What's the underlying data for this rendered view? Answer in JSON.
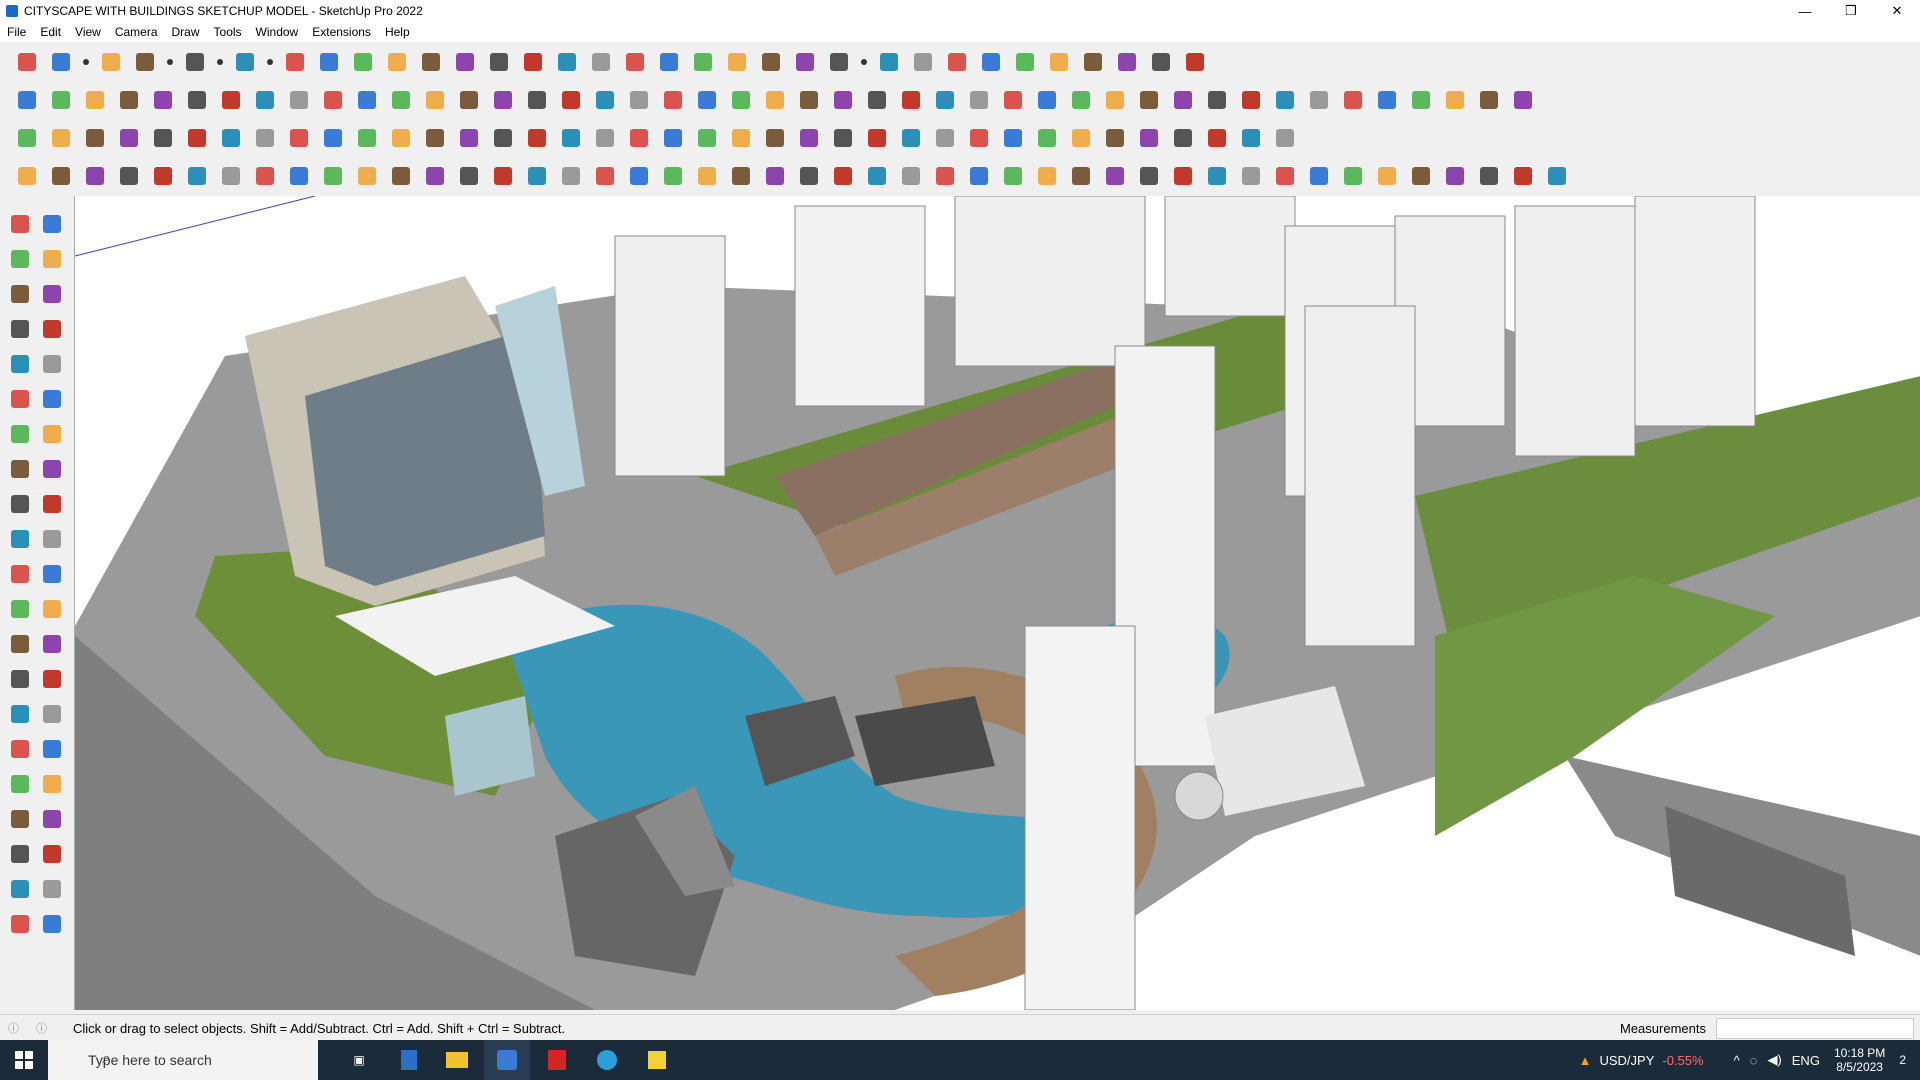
{
  "window": {
    "title": "CITYSCAPE WITH BUILDINGS SKETCHUP MODEL - SketchUp Pro 2022",
    "minimize": "—",
    "maximize": "❒",
    "close": "✕"
  },
  "menu": [
    "File",
    "Edit",
    "View",
    "Camera",
    "Draw",
    "Tools",
    "Window",
    "Extensions",
    "Help"
  ],
  "toolbar_rows": [
    [
      "zoom-icon",
      "select-icon",
      "dropdown-icon",
      "eraser-icon",
      "pencil-icon",
      "dropdown-icon",
      "lasso-icon",
      "dropdown-icon",
      "shape-icon",
      "dropdown-icon",
      "push-pull-icon",
      "follow-me-icon",
      "move-icon",
      "rotate-icon",
      "scale-icon",
      "tape-icon",
      "text-icon",
      "paint-icon",
      "orbit-icon",
      "pan-icon",
      "zoom-icon",
      "zoom-extents-icon",
      "component-icon",
      "sandbox-icon",
      "layers-icon",
      "styles-icon",
      "user-icon",
      "dropdown-icon",
      "warehouse-icon",
      "extension-icon",
      "section-icon",
      "align-icon",
      "flip-icon",
      "explode-icon",
      "hide-icon",
      "undo-icon",
      "redo-icon",
      "geo-icon"
    ],
    [
      "box-icon",
      "box-icon",
      "box-icon",
      "arrow-down-icon",
      "arrow-down-icon",
      "arrow-down-icon",
      "arrow-down-icon",
      "arrow-down-icon",
      "arrow-down-icon",
      "arrow-down-icon",
      "arc-icon",
      "line-icon",
      "line-icon",
      "line-icon",
      "plane-icon",
      "plane-icon",
      "house-icon",
      "house-icon",
      "house-icon",
      "house-icon",
      "house-icon",
      "house-icon",
      "text-tool-icon",
      "shape-icon",
      "pen-icon",
      "circle-icon",
      "circle-icon",
      "circle-icon",
      "circle-icon",
      "circle-icon",
      "circle-icon",
      "circle-icon",
      "circle-icon",
      "circle-icon",
      "circle-icon",
      "circle-icon",
      "pencil-icon",
      "eraser-icon",
      "cube-icon",
      "cube-icon",
      "cube-icon",
      "cube-icon",
      "cube-icon",
      "cube-icon",
      "cube-icon"
    ],
    [
      "gem-icon",
      "gem-icon",
      "gem-icon",
      "gem-icon",
      "gem-icon",
      "gem-icon",
      "curve-icon",
      "rect-icon",
      "rect-icon",
      "rect-icon",
      "rect-icon",
      "rect-icon",
      "rect-icon",
      "curve-icon",
      "cross-icon",
      "cross-icon",
      "cross-icon",
      "cone-icon",
      "cone-icon",
      "triangle-icon",
      "loop-icon",
      "loop-icon",
      "loop-icon",
      "plus-icon",
      "cube-icon",
      "redo-icon",
      "cube-icon",
      "cube-icon",
      "cube-icon",
      "cube-icon",
      "gem-icon",
      "grid-icon",
      "grid-icon",
      "grid-icon",
      "grid-icon",
      "grid-icon",
      "arc-icon",
      "grid-icon"
    ],
    [
      "grid-icon",
      "curve-icon",
      "curve-icon",
      "scissors-icon",
      "star-icon",
      "star-icon",
      "bend-icon",
      "cube-icon",
      "sphere-icon",
      "bend-icon",
      "line-icon",
      "line-icon",
      "line-icon",
      "line-icon",
      "frame-icon",
      "frame-icon",
      "stair-icon",
      "stair-icon",
      "stair-icon",
      "stair-icon",
      "stair-icon",
      "stair-icon",
      "stair-icon",
      "stair-icon",
      "stair-icon",
      "stair-icon",
      "stair-icon",
      "stair-icon",
      "stair-icon",
      "stair-icon",
      "stair-icon",
      "stair-icon",
      "stair-icon",
      "stair-icon",
      "stair-icon",
      "stair-icon",
      "stair-icon",
      "stair-icon",
      "stair-icon",
      "stair-icon",
      "stair-icon",
      "stair-icon",
      "stair-icon",
      "stair-icon",
      "stair-icon",
      "stair-icon"
    ]
  ],
  "left_tools": [
    "select-icon",
    "orbit-icon",
    "paint-icon",
    "eraser-icon",
    "cube-icon",
    "pencil-icon",
    "line-icon",
    "freehand-icon",
    "rect-icon",
    "rotated-rect-icon",
    "circle-icon",
    "polygon-icon",
    "arc-icon",
    "arc-icon",
    "pie-icon",
    "arc-icon",
    "move-icon",
    "push-pull-icon",
    "rotate-icon",
    "follow-me-icon",
    "scale-icon",
    "offset-icon",
    "tape-icon",
    "dimension-icon",
    "protractor-icon",
    "text-icon",
    "axes-icon",
    "3d-text-icon",
    "orbit-icon",
    "pan-icon",
    "zoom-icon",
    "zoom-window-icon",
    "zoom-extents-icon",
    "previous-icon",
    "position-camera-icon",
    "look-around-icon",
    "walk-icon",
    "section-icon",
    "sandbox-icon",
    "sandbox-icon",
    "sandbox-icon",
    "sandbox-icon"
  ],
  "status": {
    "text": "Click or drag to select objects. Shift = Add/Subtract. Ctrl = Add. Shift + Ctrl = Subtract.",
    "measurements_label": "Measurements",
    "measurements_value": ""
  },
  "taskbar": {
    "search_placeholder": "Type here to search",
    "ticker": "USD/JPY",
    "ticker_change": "-0.55%",
    "lang": "ENG",
    "time": "10:18 PM",
    "date": "8/5/2023",
    "notification_count": "2"
  },
  "colors": {
    "water": "#3b97b8",
    "grass": "#6b8e3e",
    "road": "#7c7c7c",
    "building": "#e9e9e9"
  }
}
